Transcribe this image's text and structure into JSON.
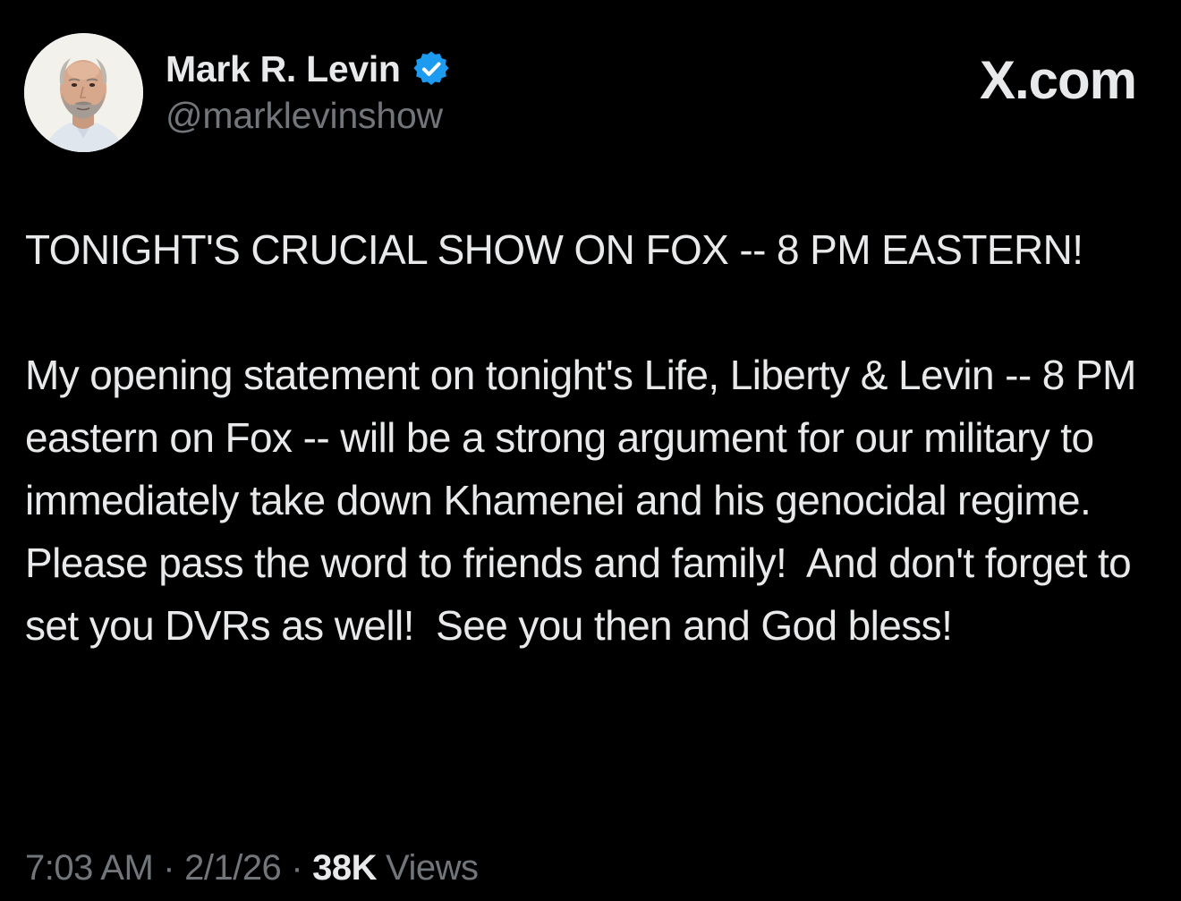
{
  "author": {
    "display_name": "Mark R. Levin",
    "handle": "@marklevinshow",
    "verified": true,
    "verified_color": "#1d9bf0"
  },
  "brand": "X.com",
  "tweet": {
    "paragraph_1": "TONIGHT'S CRUCIAL SHOW ON FOX -- 8 PM EASTERN!",
    "paragraph_2": "My opening statement on tonight's Life, Liberty & Levin -- 8 PM eastern on Fox -- will be a strong argument for our military to immediately take down Khamenei and his genocidal regime.  Please pass the word to friends and family!  And don't forget to set you DVRs as well!  See you then and God bless!"
  },
  "meta": {
    "time": "7:03 AM",
    "separator": "·",
    "date": "2/1/26",
    "views_count": "38K",
    "views_label": "Views"
  },
  "colors": {
    "background": "#000000",
    "primary_text": "#e7e9ea",
    "secondary_text": "#71767b"
  }
}
